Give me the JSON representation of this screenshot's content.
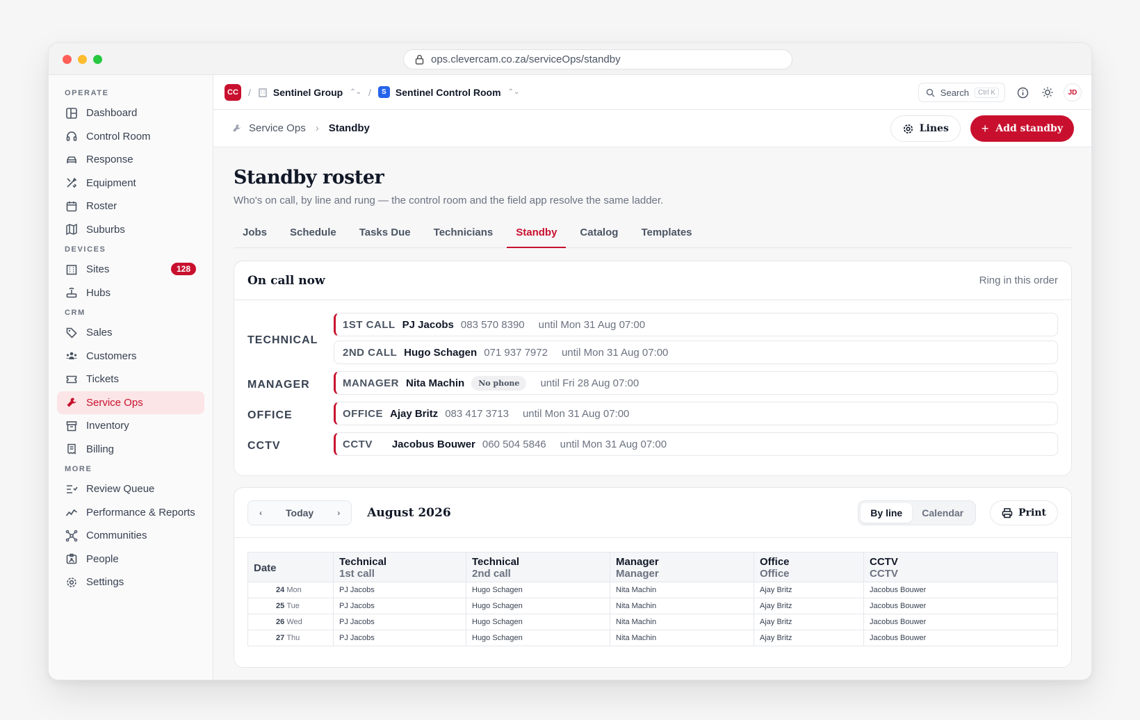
{
  "browser": {
    "url": "ops.clevercam.co.za/serviceOps/standby"
  },
  "sidebar": {
    "sections": [
      {
        "label": "OPERATE",
        "items": [
          "Dashboard",
          "Control Room",
          "Response",
          "Equipment",
          "Roster",
          "Suburbs"
        ]
      },
      {
        "label": "DEVICES",
        "items": [
          "Sites",
          "Hubs"
        ],
        "sites_badge": "128"
      },
      {
        "label": "CRM",
        "items": [
          "Sales",
          "Customers",
          "Tickets",
          "Service Ops",
          "Inventory",
          "Billing"
        ]
      },
      {
        "label": "MORE",
        "items": [
          "Review Queue",
          "Performance & Reports",
          "Communities",
          "People",
          "Settings"
        ]
      }
    ],
    "active": "Service Ops"
  },
  "topbar": {
    "org_logo": "CC",
    "org": "Sentinel Group",
    "workspace_logo": "S",
    "workspace": "Sentinel Control Room",
    "search_label": "Search",
    "search_shortcut": "Ctrl K",
    "avatar": "JD"
  },
  "pagehead": {
    "breadcrumb_parent": "Service Ops",
    "breadcrumb_current": "Standby",
    "lines_button": "Lines",
    "add_button": "Add standby"
  },
  "page": {
    "title": "Standby roster",
    "subtitle": "Who's on call, by line and rung — the control room and the field app resolve the same ladder.",
    "tabs": [
      "Jobs",
      "Schedule",
      "Tasks Due",
      "Technicians",
      "Standby",
      "Catalog",
      "Templates"
    ],
    "active_tab": "Standby"
  },
  "oncall": {
    "title": "On call now",
    "hint": "Ring in this order",
    "lines": [
      {
        "label": "TECHNICAL",
        "rungs": [
          {
            "role": "1ST CALL",
            "name": "PJ Jacobs",
            "phone": "083 570 8390",
            "until": "until Mon 31 Aug 07:00"
          },
          {
            "role": "2ND CALL",
            "name": "Hugo Schagen",
            "phone": "071 937 7972",
            "until": "until Mon 31 Aug 07:00"
          }
        ]
      },
      {
        "label": "MANAGER",
        "rungs": [
          {
            "role": "MANAGER",
            "name": "Nita Machin",
            "phone": "No phone",
            "until": "until Fri 28 Aug 07:00"
          }
        ]
      },
      {
        "label": "OFFICE",
        "rungs": [
          {
            "role": "OFFICE",
            "name": "Ajay Britz",
            "phone": "083 417 3713",
            "until": "until Mon 31 Aug 07:00"
          }
        ]
      },
      {
        "label": "CCTV",
        "rungs": [
          {
            "role": "CCTV",
            "name": "Jacobus Bouwer",
            "phone": "060 504 5846",
            "until": "until Mon 31 Aug 07:00"
          }
        ]
      }
    ]
  },
  "calendar": {
    "today": "Today",
    "month": "August 2026",
    "view_by_line": "By line",
    "view_calendar": "Calendar",
    "print": "Print",
    "columns": [
      {
        "title": "Date",
        "sub": ""
      },
      {
        "title": "Technical",
        "sub": "1st call"
      },
      {
        "title": "Technical",
        "sub": "2nd call"
      },
      {
        "title": "Manager",
        "sub": "Manager"
      },
      {
        "title": "Office",
        "sub": "Office"
      },
      {
        "title": "CCTV",
        "sub": "CCTV"
      }
    ],
    "rows": [
      {
        "day": "24",
        "wd": "Mon",
        "cells": [
          "PJ Jacobs",
          "Hugo Schagen",
          "Nita Machin",
          "Ajay Britz",
          "Jacobus Bouwer"
        ]
      },
      {
        "day": "25",
        "wd": "Tue",
        "cells": [
          "PJ Jacobs",
          "Hugo Schagen",
          "Nita Machin",
          "Ajay Britz",
          "Jacobus Bouwer"
        ]
      },
      {
        "day": "26",
        "wd": "Wed",
        "cells": [
          "PJ Jacobs",
          "Hugo Schagen",
          "Nita Machin",
          "Ajay Britz",
          "Jacobus Bouwer"
        ]
      },
      {
        "day": "27",
        "wd": "Thu",
        "cells": [
          "PJ Jacobs",
          "Hugo Schagen",
          "Nita Machin",
          "Ajay Britz",
          "Jacobus Bouwer"
        ]
      }
    ]
  },
  "colors": {
    "accent": "#c8102e",
    "workspace": "#2563eb"
  }
}
